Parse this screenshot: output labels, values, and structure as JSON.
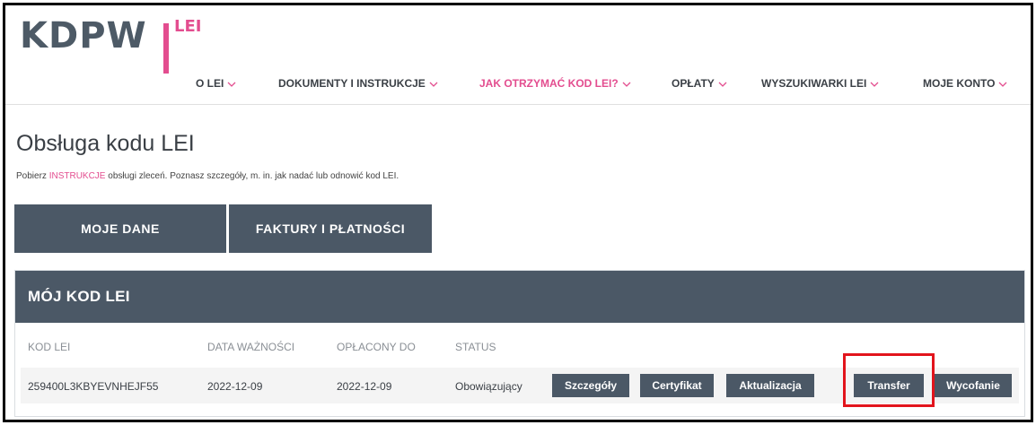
{
  "logo": {
    "brand": "KDPW",
    "product": "LEI"
  },
  "nav": [
    {
      "label": "O LEI",
      "active": false
    },
    {
      "label": "DOKUMENTY I INSTRUKCJE",
      "active": false
    },
    {
      "label": "JAK OTRZYMAĆ KOD LEI?",
      "active": true
    },
    {
      "label": "OPŁATY",
      "active": false
    },
    {
      "label": "WYSZUKIWARKI LEI",
      "active": false
    },
    {
      "label": "MOJE KONTO",
      "active": false
    }
  ],
  "page": {
    "title": "Obsługa kodu LEI",
    "intro_prefix": "Pobierz ",
    "intro_link": "INSTRUKCJE",
    "intro_suffix": " obsługi zleceń. Poznasz szczegóły, m. in. jak nadać lub odnowić kod LEI."
  },
  "tabs": [
    {
      "label": "MOJE DANE"
    },
    {
      "label": "FAKTURY I PŁATNOŚCI"
    }
  ],
  "lei_panel": {
    "title": "MÓJ KOD LEI",
    "columns": [
      "KOD LEI",
      "DATA WAŻNOŚCI",
      "OPŁACONY DO",
      "STATUS"
    ],
    "row": {
      "kod": "259400L3KBYEVNHEJF55",
      "data_waznosci": "2022-12-09",
      "oplacony_do": "2022-12-09",
      "status": "Obowiązujący"
    },
    "actions": [
      "Szczegóły",
      "Certyfikat",
      "Aktualizacja",
      "Transfer",
      "Wycofanie"
    ]
  },
  "colors": {
    "accent": "#e34d8f",
    "dark": "#4b5866",
    "highlight": "#e2141c"
  }
}
